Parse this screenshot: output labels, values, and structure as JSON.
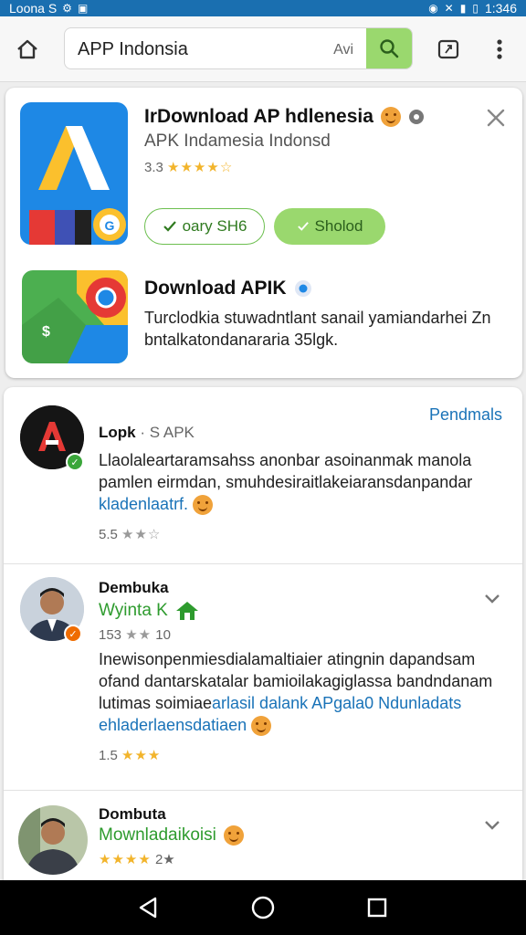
{
  "status_bar": {
    "left_text": "Loona S",
    "time": "1:346"
  },
  "browser": {
    "url_text": "APP Indonsia",
    "url_sub": "Avi"
  },
  "top_card": {
    "app_title": "IrDownload AP hdlenesia",
    "app_subtitle": "APK Indamesia Indonsd",
    "rating_value": "3.3",
    "rating_stars": "★★★★☆",
    "button_outline_label": "oary SH6",
    "button_filled_label": "Sholod",
    "download_title": "Download APIK",
    "download_desc": "Turclodkia stuwadntlant sanail yamiandarhei Zn bntalkatondanararia 35lgk."
  },
  "reviews": [
    {
      "name": "Lopk",
      "meta": "· S APK",
      "link": "Pendmals",
      "body_line1": "Llaolaleartaramsahss anonbar asoinanmak manola",
      "body_line2": "pamlen eirmdan, smuhdesiraitlakeiaransdanpandar",
      "body_link": "kladenlaatrf.",
      "rating_value": "5.5",
      "rating_stars": "★★☆"
    },
    {
      "name": "Dembuka",
      "subtitle": "Wyinta K",
      "rating_value": "153",
      "rating_stars": "★★",
      "rating_count": "10",
      "body_line1": "Inewisonpenmiesdialamaltiaier atingnin dapandsam",
      "body_line2": "ofand dantarskatalar bamioilakagiglassa bandndanam",
      "body_line3_plain": "lutimas soimiae",
      "body_line3_link": "arlasil dalank APgala0 Ndunladats",
      "body_line4": "ehladerlaensdatiaen",
      "rating2_value": "1.5",
      "rating2_stars": "★★★"
    },
    {
      "name": "Dombuta",
      "subtitle": "Mownladaikoisi",
      "rating_stars": "★★★★",
      "rating_extra": "2★"
    }
  ],
  "colors": {
    "accent_green": "#9ad86e",
    "link_blue": "#1a73b8",
    "status_blue": "#1a6fb0"
  }
}
